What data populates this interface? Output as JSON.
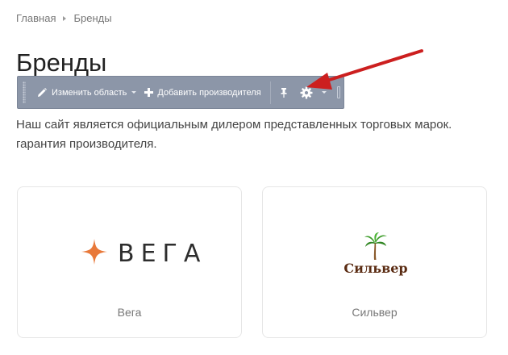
{
  "breadcrumb": {
    "items": [
      "Главная",
      "Бренды"
    ]
  },
  "page": {
    "title": "Бренды"
  },
  "toolbar": {
    "edit_area_label": "Изменить область",
    "add_manufacturer_label": "Добавить производителя"
  },
  "intro": {
    "line1": "Наш сайт является официальным дилером представленных торговых марок.",
    "line2": "гарантия производителя."
  },
  "brands": [
    {
      "name": "Вега",
      "logo_text": "ВЕГА"
    },
    {
      "name": "Сильвер",
      "logo_text": "Сильвер"
    }
  ],
  "colors": {
    "toolbar_bg": "#8c96a8",
    "arrow": "#cc1f1f",
    "vega_star": "#e8793a",
    "silver_text": "#5a2b12",
    "palm_leaves": "#3f9e2c"
  },
  "icons": [
    "pencil-icon",
    "plus-icon",
    "pin-icon",
    "gear-icon",
    "chevron-down-icon",
    "star-icon",
    "palm-tree-icon"
  ]
}
